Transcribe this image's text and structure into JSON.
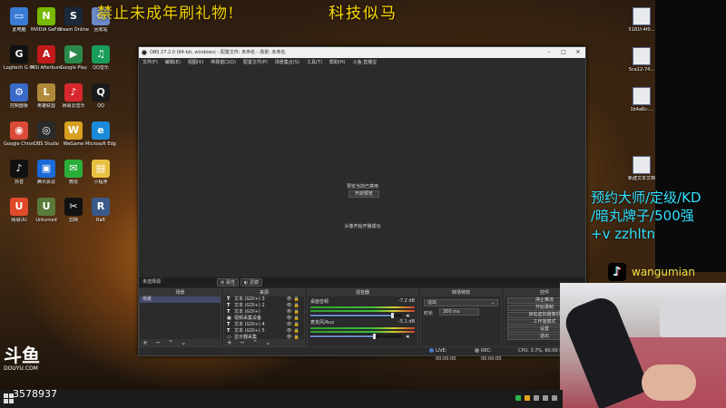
{
  "overlay": {
    "title_left": "禁止未成年刷礼物!",
    "title_right": "科技似马",
    "ad_lines": [
      "预约大师/定级/KD",
      "/暗丸牌子/500强",
      "+v zzhltn"
    ],
    "douyin_name": "wangumian",
    "douyin_logo": "♪",
    "room_id": "3578937",
    "douyu_mark": "斗鱼",
    "douyu_url": "DOUYU.COM"
  },
  "desktop_icons": [
    {
      "label": "此电脑",
      "icon": "computer-icon",
      "color": "#3a7bd5",
      "glyph": "▭"
    },
    {
      "label": "NVIDIA GeForce",
      "icon": "nvidia-icon",
      "color": "#76b900",
      "glyph": "N"
    },
    {
      "label": "Steam Online",
      "icon": "steam-icon",
      "color": "#1b2838",
      "glyph": "S"
    },
    {
      "label": "回收站",
      "icon": "recycle-bin-icon",
      "color": "#6a8ac8",
      "glyph": "♻"
    },
    {
      "label": "Logitech G HUB",
      "icon": "logitech-icon",
      "color": "#111111",
      "glyph": "G"
    },
    {
      "label": "MSI Afterburner",
      "icon": "afterburner-icon",
      "color": "#c21a1a",
      "glyph": "A"
    },
    {
      "label": "Google Play",
      "icon": "play-store-icon",
      "color": "#2a8a4a",
      "glyph": "▶"
    },
    {
      "label": "QQ音乐",
      "icon": "qq-music-icon",
      "color": "#1a9d5a",
      "glyph": "♫"
    },
    {
      "label": "控制面板",
      "icon": "control-panel-icon",
      "color": "#3a6ac8",
      "glyph": "⚙"
    },
    {
      "label": "英雄联盟",
      "icon": "lol-icon",
      "color": "#b08a3a",
      "glyph": "L"
    },
    {
      "label": "网易云音乐",
      "icon": "netease-music-icon",
      "color": "#d8282e",
      "glyph": "♪"
    },
    {
      "label": "QQ",
      "icon": "qq-icon",
      "color": "#1a1a1a",
      "glyph": "Q"
    },
    {
      "label": "Google Chrome",
      "icon": "chrome-icon",
      "color": "#d94a38",
      "glyph": "◉"
    },
    {
      "label": "OBS Studio",
      "icon": "obs-icon",
      "color": "#2a2a2a",
      "glyph": "◎"
    },
    {
      "label": "WeGame",
      "icon": "wegame-icon",
      "color": "#d8a020",
      "glyph": "W"
    },
    {
      "label": "Microsoft Edge",
      "icon": "edge-icon",
      "color": "#1b8ad8",
      "glyph": "e"
    },
    {
      "label": "抖音",
      "icon": "douyin-icon",
      "color": "#111111",
      "glyph": "♪"
    },
    {
      "label": "腾讯会议",
      "icon": "meeting-icon",
      "color": "#1a6ad8",
      "glyph": "▣"
    },
    {
      "label": "微信",
      "icon": "wechat-icon",
      "color": "#2aae3a",
      "glyph": "✉"
    },
    {
      "label": "小程序",
      "icon": "folder-icon",
      "color": "#e8c040",
      "glyph": "▤"
    },
    {
      "label": "网易UU",
      "icon": "uu-icon",
      "color": "#e04a2a",
      "glyph": "U"
    },
    {
      "label": "Unturned",
      "icon": "unturned-icon",
      "color": "#5a7a3a",
      "glyph": "U"
    },
    {
      "label": "剪映",
      "icon": "capcut-icon",
      "color": "#111111",
      "glyph": "✂"
    },
    {
      "label": "Raft",
      "icon": "raft-icon",
      "color": "#3a5a8a",
      "glyph": "R"
    }
  ],
  "right_files": [
    "5181f-4f0...",
    "5ca12-74...",
    "1b4a6c-...",
    "新建文本文档"
  ],
  "obs": {
    "title": "OBS 27.2.0 (64-bit, windows) - 配置文件: 未命名 - 场景: 未命名",
    "menu": [
      "文件(F)",
      "编辑(E)",
      "视图(V)",
      "停靠窗口(D)",
      "配置文件(P)",
      "场景集合(S)",
      "工具(T)",
      "帮助(H)",
      "斗鱼·直播宝"
    ],
    "preview_hint": "预览当前已禁用",
    "preview_button": "开启预览",
    "preview_status": "头像开始开播成功",
    "source_status": "未选择源",
    "toolbar_props": "属性",
    "toolbar_filters": "滤镜",
    "scenes_title": "场景",
    "scenes": [
      "场景"
    ],
    "sources_title": "来源",
    "sources": [
      {
        "name": "文本 (GDI+) 3",
        "type": "T"
      },
      {
        "name": "文本 (GDI+) 2",
        "type": "T"
      },
      {
        "name": "文本 (GDI+)",
        "type": "T"
      },
      {
        "name": "视频采集设备",
        "type": "▣"
      },
      {
        "name": "文本 (GDI+) 4",
        "type": "T"
      },
      {
        "name": "文本 (GDI+) 5",
        "type": "T"
      },
      {
        "name": "显示器采集",
        "type": "▭"
      }
    ],
    "mixer_title": "混音器",
    "mixer": [
      {
        "name": "桌面音频",
        "db": "-7.2 dB",
        "level": 0.9
      },
      {
        "name": "麦克风/Aux",
        "db": "-5.1 dB",
        "level": 0.7
      }
    ],
    "transitions_title": "转场特效",
    "transition": "淡出",
    "duration_label": "时长",
    "duration": "300 ms",
    "controls_title": "控件",
    "controls": [
      "停止推流",
      "开始录制",
      "启动虚拟摄像机",
      "工作室模式",
      "设置",
      "退出"
    ],
    "dock_footer": "+ − ⌃ ⌄",
    "status": {
      "live": "LIVE: 00:00:00",
      "rec": "REC: 00:00:00",
      "cpu": "CPU: 3.7%, 60.00 fps"
    }
  }
}
